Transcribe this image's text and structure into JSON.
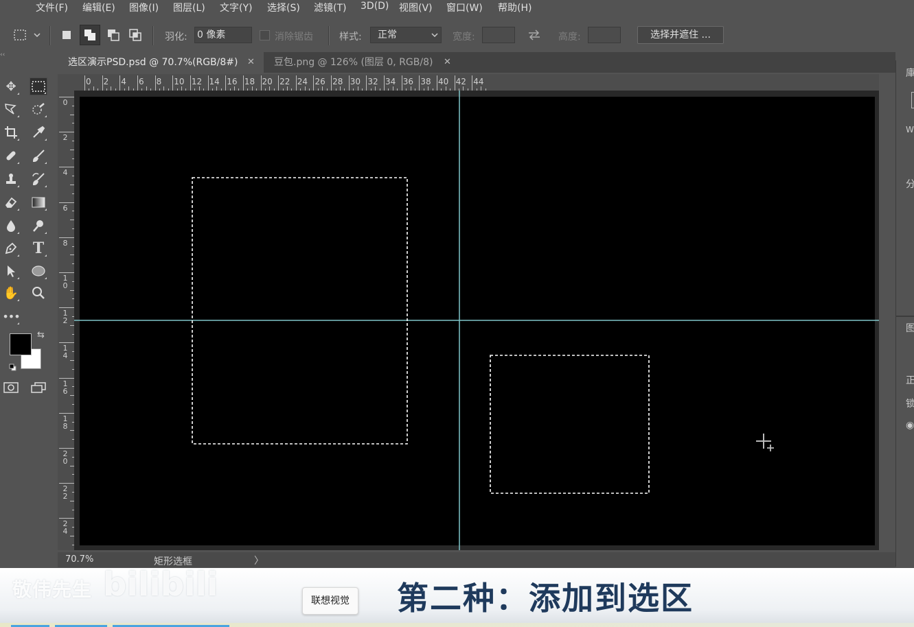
{
  "menu": [
    "文件(F)",
    "编辑(E)",
    "图像(I)",
    "图层(L)",
    "文字(Y)",
    "选择(S)",
    "滤镜(T)",
    "3D(D)",
    "视图(V)",
    "窗口(W)",
    "帮助(H)"
  ],
  "options_bar": {
    "feather_label": "羽化:",
    "feather_value": "0 像素",
    "antialias_label": "消除锯齿",
    "style_label": "样式:",
    "style_value": "正常",
    "width_label": "宽度:",
    "height_label": "高度:",
    "select_mask_label": "选择并遮住 ..."
  },
  "tabs": [
    {
      "label": "选区演示PSD.psd @ 70.7%(RGB/8#)",
      "active": true
    },
    {
      "label": "豆包.png @ 126% (图层 0, RGB/8)",
      "active": false
    }
  ],
  "ruler_top": [
    "0",
    "2",
    "4",
    "6",
    "8",
    "10",
    "12",
    "14",
    "16",
    "18",
    "20",
    "22",
    "24",
    "26",
    "28",
    "30",
    "32",
    "34",
    "36",
    "38",
    "40",
    "42",
    "44"
  ],
  "ruler_left": [
    "0",
    "2",
    "4",
    "6",
    "8",
    "10",
    "12",
    "14",
    "16",
    "18",
    "20",
    "22",
    "24"
  ],
  "status": {
    "zoom": "70.7%",
    "info": "矩形选框",
    "arrow": "〉"
  },
  "right_panel": [
    "庫",
    "W",
    "分",
    "图",
    "正",
    "锁"
  ],
  "caption": {
    "logo": "敬伟先生",
    "logo_mark": "bilibili",
    "tooltip": "联想视觉",
    "title": "第二种：添加到选区"
  },
  "colors": {
    "ui_bg": "#535353",
    "canvas": "#000000",
    "guide": "#7fc6c9",
    "caption_text": "#1f3a5c",
    "foreground_color": "#000000",
    "background_color": "#ffffff"
  },
  "tools": [
    "move-icon",
    "rect-marquee-icon",
    "lasso-icon",
    "quick-select-icon",
    "crop-icon",
    "eyedropper-icon",
    "healing-brush-icon",
    "brush-icon",
    "clone-stamp-icon",
    "history-brush-icon",
    "eraser-icon",
    "gradient-icon",
    "blur-icon",
    "dodge-icon",
    "pen-icon",
    "type-icon",
    "path-select-icon",
    "ellipse-icon",
    "hand-icon",
    "zoom-icon",
    "more-icon"
  ]
}
